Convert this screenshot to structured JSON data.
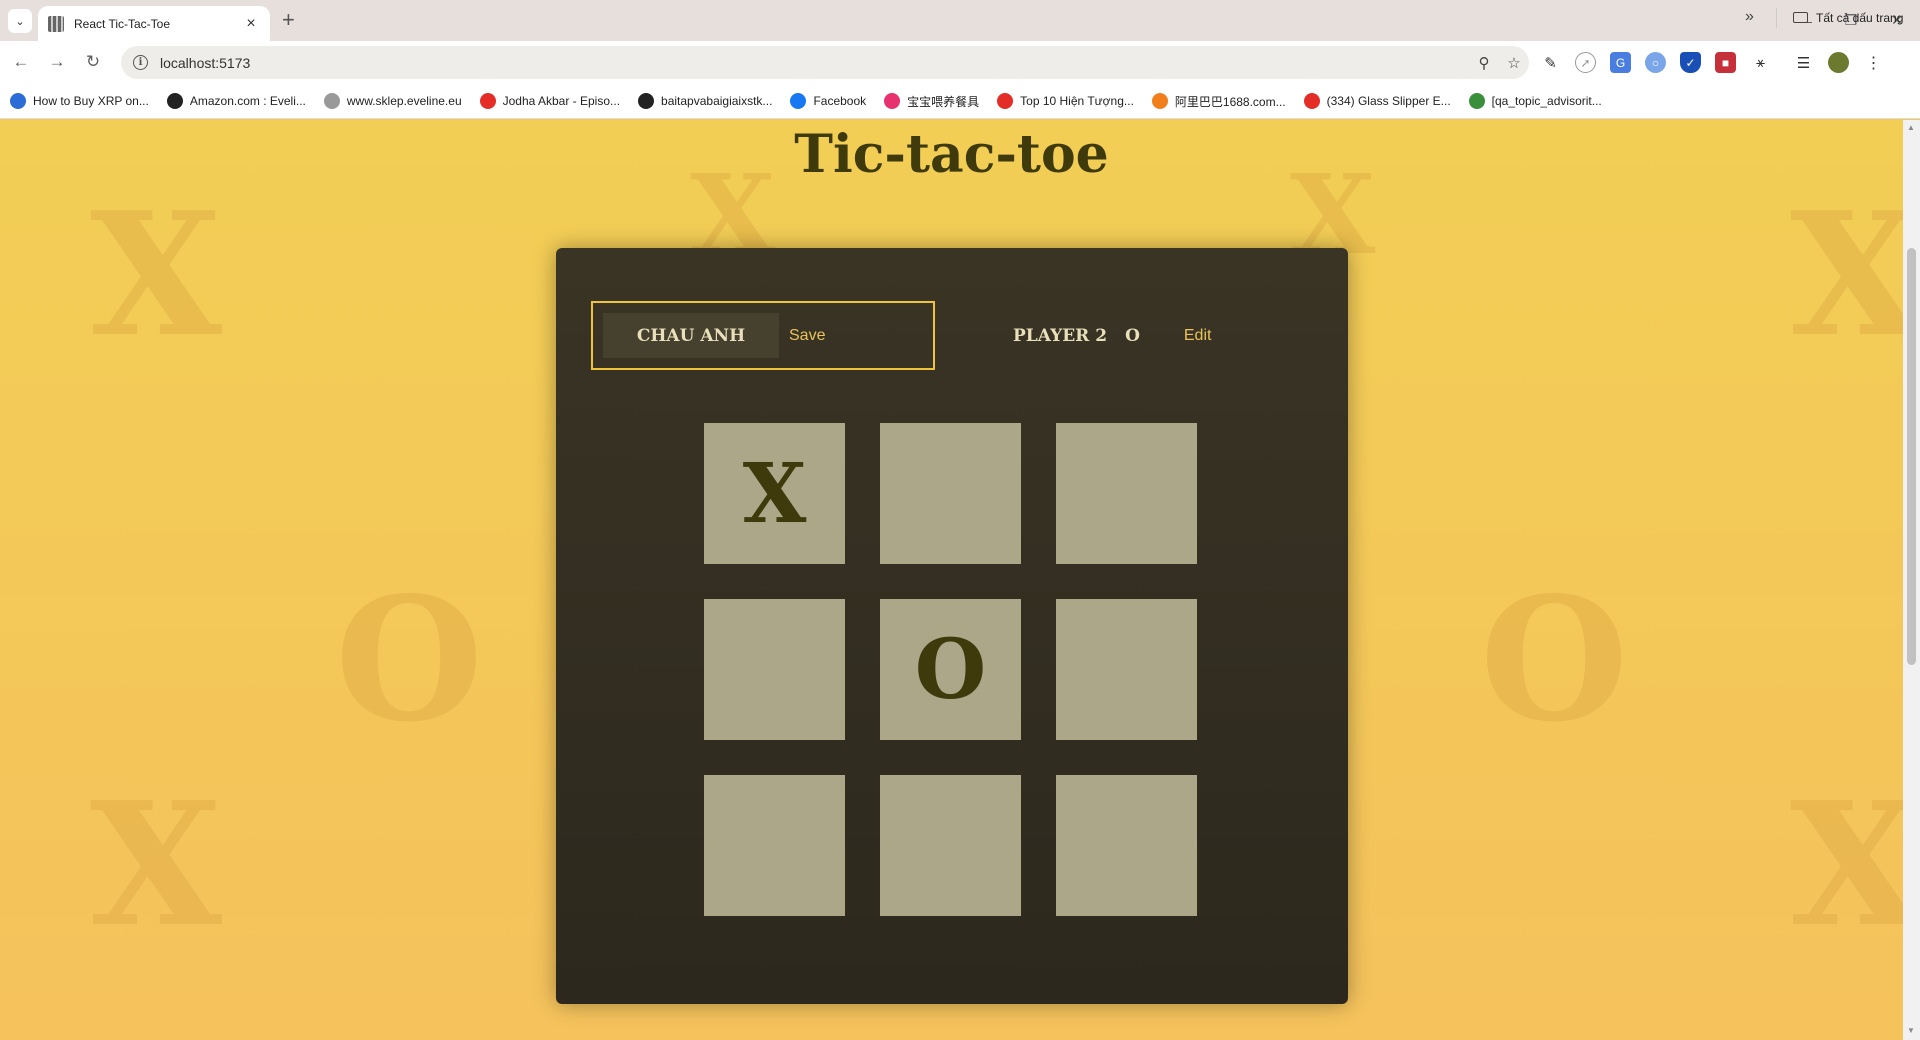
{
  "browser": {
    "tab_title": "React Tic-Tac-Toe",
    "url": "localhost:5173",
    "bookmarks": [
      {
        "label": "How to Buy XRP on...",
        "icon": "xrp-icon",
        "color": "#2b6cd6"
      },
      {
        "label": "Amazon.com : Eveli...",
        "icon": "amazon-icon",
        "color": "#222222"
      },
      {
        "label": "www.sklep.eveline.eu",
        "icon": "eveline-icon",
        "color": "#999999"
      },
      {
        "label": "Jodha Akbar - Episo...",
        "icon": "youtube-icon",
        "color": "#e52d27"
      },
      {
        "label": "baitapvabaigiaixstk...",
        "icon": "site-icon",
        "color": "#222222"
      },
      {
        "label": "Facebook",
        "icon": "facebook-icon",
        "color": "#1877f2"
      },
      {
        "label": "宝宝喂养餐具",
        "icon": "taobao-icon",
        "color": "#e8316f"
      },
      {
        "label": "Top 10 Hiện Tượng...",
        "icon": "youtube-icon",
        "color": "#e52d27"
      },
      {
        "label": "阿里巴巴1688.com...",
        "icon": "alibaba-icon",
        "color": "#f07f1c"
      },
      {
        "label": "(334) Glass Slipper E...",
        "icon": "youtube-icon",
        "color": "#e52d27"
      },
      {
        "label": "[qa_topic_advisorit...",
        "icon": "qa-icon",
        "color": "#3a8f3a"
      }
    ],
    "bookmarks_folder": "Tất cả dấu trang"
  },
  "game": {
    "title": "Tic-tac-toe",
    "player1": {
      "name": "CHAU ANH",
      "button": "Save"
    },
    "player2": {
      "name": "PLAYER 2",
      "symbol": "O",
      "button": "Edit"
    },
    "board": [
      "X",
      "",
      "",
      "",
      "O",
      "",
      "",
      "",
      ""
    ]
  },
  "colors": {
    "background": "#f3c95a",
    "panel": "#332e21",
    "cell": "#aca789",
    "mark": "#3f3a0c",
    "active_border": "#f0c23a"
  }
}
